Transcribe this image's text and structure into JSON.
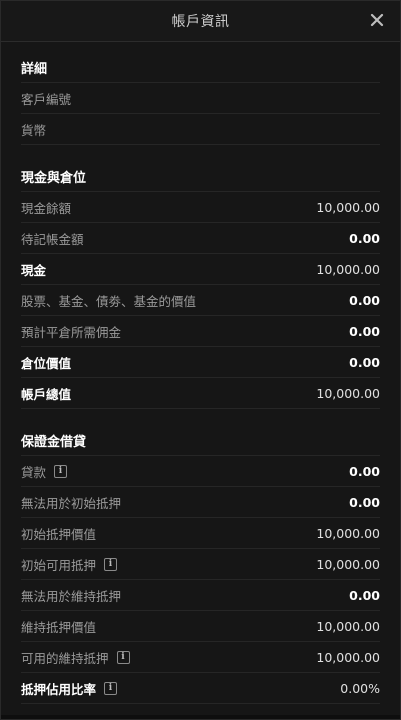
{
  "header": {
    "title": "帳戶資訊",
    "close_icon": "close-icon"
  },
  "details": {
    "title": "詳細",
    "rows": [
      {
        "label": "客戶編號",
        "value": ""
      },
      {
        "label": "貨幣",
        "value": ""
      }
    ]
  },
  "cash_positions": {
    "title": "現金與倉位",
    "rows": [
      {
        "label": "現金餘額",
        "value": "10,000.00"
      },
      {
        "label": "待記帳金額",
        "value": "0.00"
      },
      {
        "label": "現金",
        "value": "10,000.00"
      },
      {
        "label": "股票、基金、債劵、基金的價值",
        "value": "0.00"
      },
      {
        "label": "預計平倉所需佣金",
        "value": "0.00"
      },
      {
        "label": "倉位價值",
        "value": "0.00"
      },
      {
        "label": "帳戶總值",
        "value": "10,000.00"
      }
    ]
  },
  "margin": {
    "title": "保證金借貸",
    "rows": [
      {
        "label": "貸款",
        "value": "0.00",
        "info": true
      },
      {
        "label": "無法用於初始抵押",
        "value": "0.00"
      },
      {
        "label": "初始抵押價值",
        "value": "10,000.00"
      },
      {
        "label": "初始可用抵押",
        "value": "10,000.00",
        "info": true
      },
      {
        "label": "無法用於維持抵押",
        "value": "0.00"
      },
      {
        "label": "維持抵押價值",
        "value": "10,000.00"
      },
      {
        "label": "可用的維持抵押",
        "value": "10,000.00",
        "info": true
      },
      {
        "label": "抵押佔用比率",
        "value": "0.00%",
        "info": true
      }
    ]
  },
  "info_icon_glyph": "i"
}
